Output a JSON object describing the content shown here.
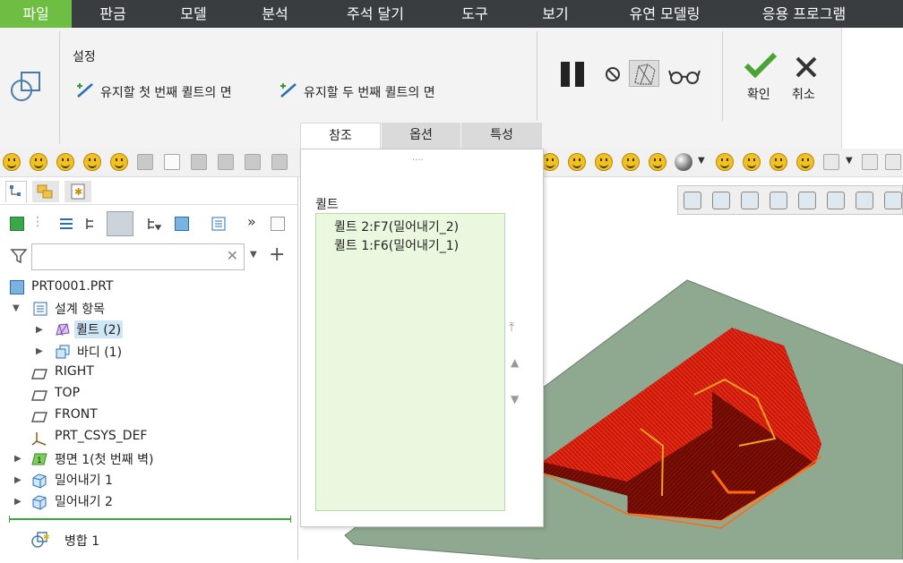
{
  "menubar": {
    "tabs": [
      "파일",
      "판금",
      "모델",
      "분석",
      "주석 달기",
      "도구",
      "보기",
      "유연 모델링",
      "응용 프로그램"
    ]
  },
  "ribbon": {
    "section_title": "설정",
    "first_face": "유지할 첫 번째 퀼트의 면",
    "second_face": "유지할 두 번째 퀼트의 면",
    "ok_label": "확인",
    "cancel_label": "취소",
    "tabs": [
      "참조",
      "옵션",
      "특성"
    ]
  },
  "tree": {
    "search_placeholder": "",
    "items": [
      {
        "label": "PRT0001.PRT"
      },
      {
        "label": "설계 항목"
      },
      {
        "label": "퀼트 (2)"
      },
      {
        "label": "바디 (1)"
      },
      {
        "label": "RIGHT"
      },
      {
        "label": "TOP"
      },
      {
        "label": "FRONT"
      },
      {
        "label": "PRT_CSYS_DEF"
      },
      {
        "label": "평면 1(첫 번째 벽)"
      },
      {
        "label": "밀어내기 1"
      },
      {
        "label": "밀어내기 2"
      },
      {
        "label": "병합 1"
      }
    ]
  },
  "popup": {
    "grip": "....",
    "list_label": "퀼트",
    "quilts": [
      "퀼트 2:F7(밀어내기_2)",
      "퀼트 1:F6(밀어내기_1)"
    ]
  },
  "colors": {
    "accent": "#6fbe44",
    "menubar": "#3a3d3f",
    "model": "#d41a0c",
    "plane": "#8fa890"
  }
}
